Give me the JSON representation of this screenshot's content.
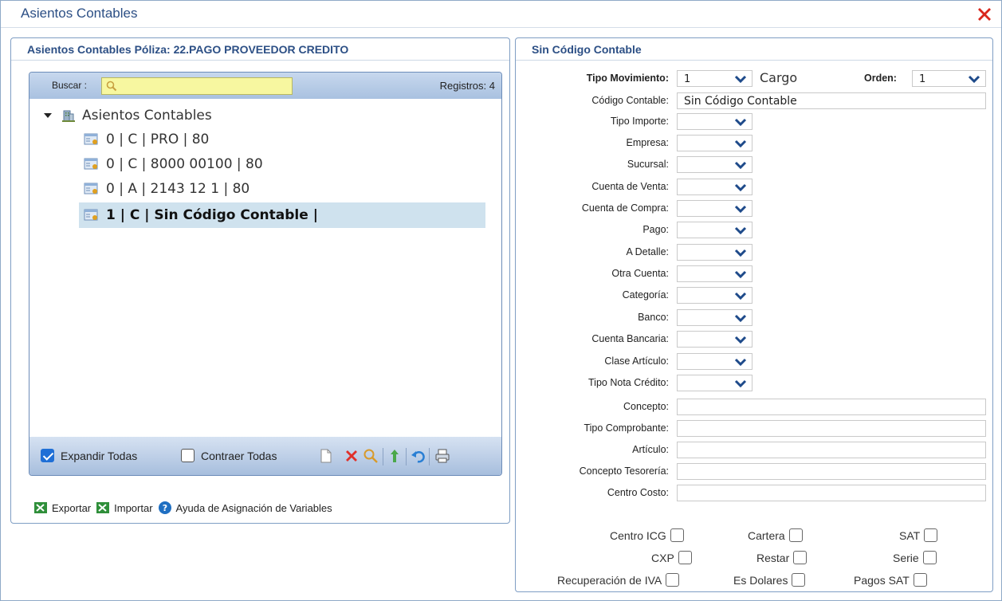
{
  "window": {
    "title": "Asientos Contables"
  },
  "left": {
    "header": "Asientos Contables Póliza: 22.PAGO PROVEEDOR CREDITO",
    "search": {
      "label": "Buscar :",
      "value": ""
    },
    "records": "Registros: 4",
    "tree": {
      "root": "Asientos Contables",
      "items": [
        "0 | C | PRO | 80",
        "0 | C | 8000 00100 | 80",
        "0 | A | 2143 12 1 | 80",
        "1 | C | Sin Código Contable |"
      ]
    },
    "bottom": {
      "expand_label": "Expandir Todas",
      "collapse_label": "Contraer Todas"
    },
    "links": {
      "export": "Exportar",
      "import": "Importar",
      "help": "Ayuda de Asignación de Variables"
    }
  },
  "right": {
    "header": "Sin Código Contable",
    "fields": {
      "tipo_movimiento": {
        "label": "Tipo Movimiento:",
        "value": "1",
        "text": "Cargo"
      },
      "orden": {
        "label": "Orden:",
        "value": "1"
      },
      "codigo_contable": {
        "label": "Código Contable:",
        "value": "Sin Código Contable"
      },
      "tipo_importe": {
        "label": "Tipo Importe:"
      },
      "empresa": {
        "label": "Empresa:"
      },
      "sucursal": {
        "label": "Sucursal:"
      },
      "cuenta_venta": {
        "label": "Cuenta de Venta:"
      },
      "cuenta_compra": {
        "label": "Cuenta de Compra:"
      },
      "pago": {
        "label": "Pago:"
      },
      "a_detalle": {
        "label": "A Detalle:"
      },
      "otra_cuenta": {
        "label": "Otra Cuenta:"
      },
      "categoria": {
        "label": "Categoría:"
      },
      "banco": {
        "label": "Banco:"
      },
      "cuenta_bancaria": {
        "label": "Cuenta Bancaria:"
      },
      "clase_articulo": {
        "label": "Clase Artículo:"
      },
      "tipo_nota_credito": {
        "label": "Tipo Nota Crédito:"
      },
      "concepto": {
        "label": "Concepto:"
      },
      "tipo_comprobante": {
        "label": "Tipo Comprobante:"
      },
      "articulo": {
        "label": "Artículo:"
      },
      "concepto_tesoreria": {
        "label": "Concepto Tesorería:"
      },
      "centro_costo": {
        "label": "Centro Costo:"
      }
    },
    "checks": {
      "centro_icg": "Centro ICG",
      "cartera": "Cartera",
      "sat": "SAT",
      "cxp": "CXP",
      "restar": "Restar",
      "serie": "Serie",
      "recuperacion_iva": "Recuperación de IVA",
      "es_dolares": "Es Dolares",
      "pagos_sat": "Pagos SAT"
    }
  },
  "colors": {
    "accent": "#2c4f85",
    "close": "#d9261c",
    "search_bg": "#f7f7a0"
  }
}
